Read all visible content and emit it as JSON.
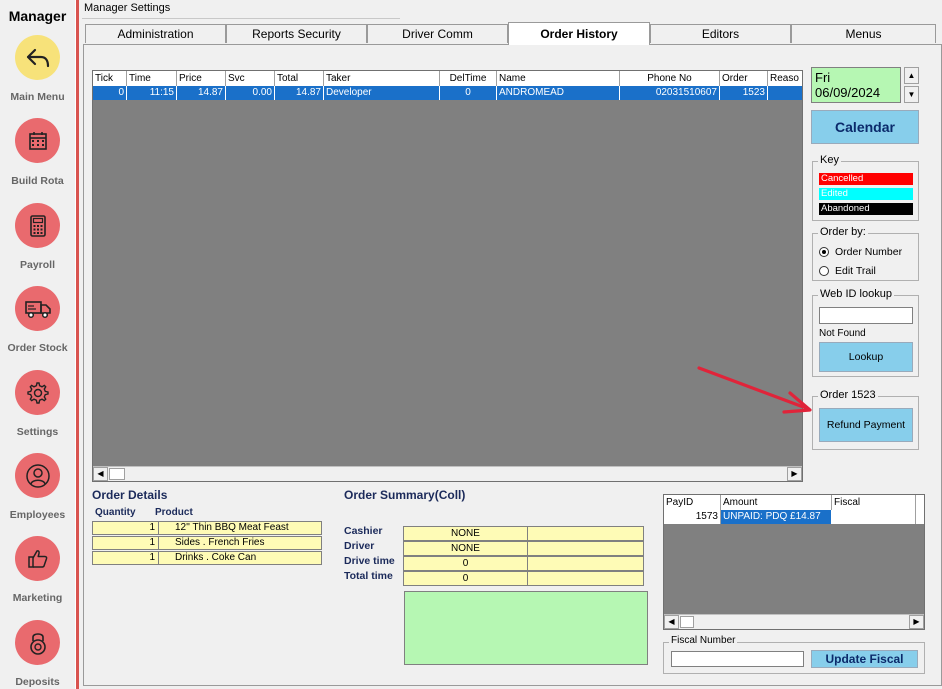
{
  "sidebar": {
    "title": "Manager",
    "items": [
      {
        "label": "Main Menu",
        "icon": "back-arrow-icon"
      },
      {
        "label": "Build Rota",
        "icon": "calendar-grid-icon"
      },
      {
        "label": "Payroll",
        "icon": "calculator-icon"
      },
      {
        "label": "Order Stock",
        "icon": "truck-icon"
      },
      {
        "label": "Settings",
        "icon": "gear-icon"
      },
      {
        "label": "Employees",
        "icon": "people-icon"
      },
      {
        "label": "Marketing",
        "icon": "thumbs-up-icon"
      },
      {
        "label": "Deposits",
        "icon": "lock-icon"
      }
    ]
  },
  "window": {
    "title": "Manager Settings"
  },
  "tabs": [
    "Administration",
    "Reports Security",
    "Driver Comm",
    "Order History",
    "Editors",
    "Menus"
  ],
  "active_tab": "Order History",
  "orders_grid": {
    "columns": [
      "Tick",
      "Time",
      "Price",
      "Svc",
      "Total",
      "Taker",
      "DelTime",
      "Name",
      "Phone No",
      "Order",
      "Reaso"
    ],
    "rows": [
      [
        "0",
        "11:15",
        "14.87",
        "0.00",
        "14.87",
        "Developer",
        "0",
        "ANDROMEAD",
        "02031510607",
        "1523",
        ""
      ]
    ]
  },
  "date": {
    "value": "Fri 06/09/2024"
  },
  "calendar_button": "Calendar",
  "key": {
    "legend": "Key",
    "items": [
      {
        "label": "Cancelled",
        "bg": "#ff0000",
        "fg": "#ffffff"
      },
      {
        "label": "Edited",
        "bg": "#00ffff",
        "fg": "#ffffff"
      },
      {
        "label": "Abandoned",
        "bg": "#000000",
        "fg": "#ffffff"
      }
    ]
  },
  "order_by": {
    "legend": "Order by:",
    "options": [
      "Order Number",
      "Edit Trail"
    ],
    "selected": "Order Number"
  },
  "web_lookup": {
    "legend": "Web ID lookup",
    "value": "",
    "status": "Not Found",
    "button": "Lookup"
  },
  "order_panel": {
    "legend": "Order 1523",
    "button": "Refund Payment"
  },
  "order_details": {
    "title": "Order Details",
    "columns": [
      "Quantity",
      "Product"
    ],
    "rows": [
      {
        "qty": "1",
        "product": "12'' Thin BBQ Meat Feast"
      },
      {
        "qty": "1",
        "product": "Sides . French Fries"
      },
      {
        "qty": "1",
        "product": "Drinks . Coke Can"
      }
    ]
  },
  "order_summary": {
    "title": "Order Summary(Coll)",
    "rows": [
      {
        "label": "Cashier",
        "value": "NONE"
      },
      {
        "label": "Driver",
        "value": "NONE"
      },
      {
        "label": "Drive time",
        "value": "0"
      },
      {
        "label": "Total time",
        "value": "0"
      }
    ]
  },
  "payments_grid": {
    "columns": [
      "PayID",
      "Amount",
      "Fiscal"
    ],
    "rows": [
      [
        "1573",
        "UNPAID: PDQ £14.87",
        ""
      ]
    ]
  },
  "fiscal": {
    "legend": "Fiscal Number",
    "value": "",
    "button": "Update Fiscal"
  },
  "colors": {
    "selection": "#1a70c9",
    "grid_bg": "#808080",
    "button_blue": "#87ceeb",
    "date_green": "#b6f7b3",
    "cell_yellow": "#fefbb6",
    "sidebar_red": "#e96a6e",
    "sidebar_yellow": "#f7e27a",
    "annotation_arrow": "#e0243a"
  }
}
